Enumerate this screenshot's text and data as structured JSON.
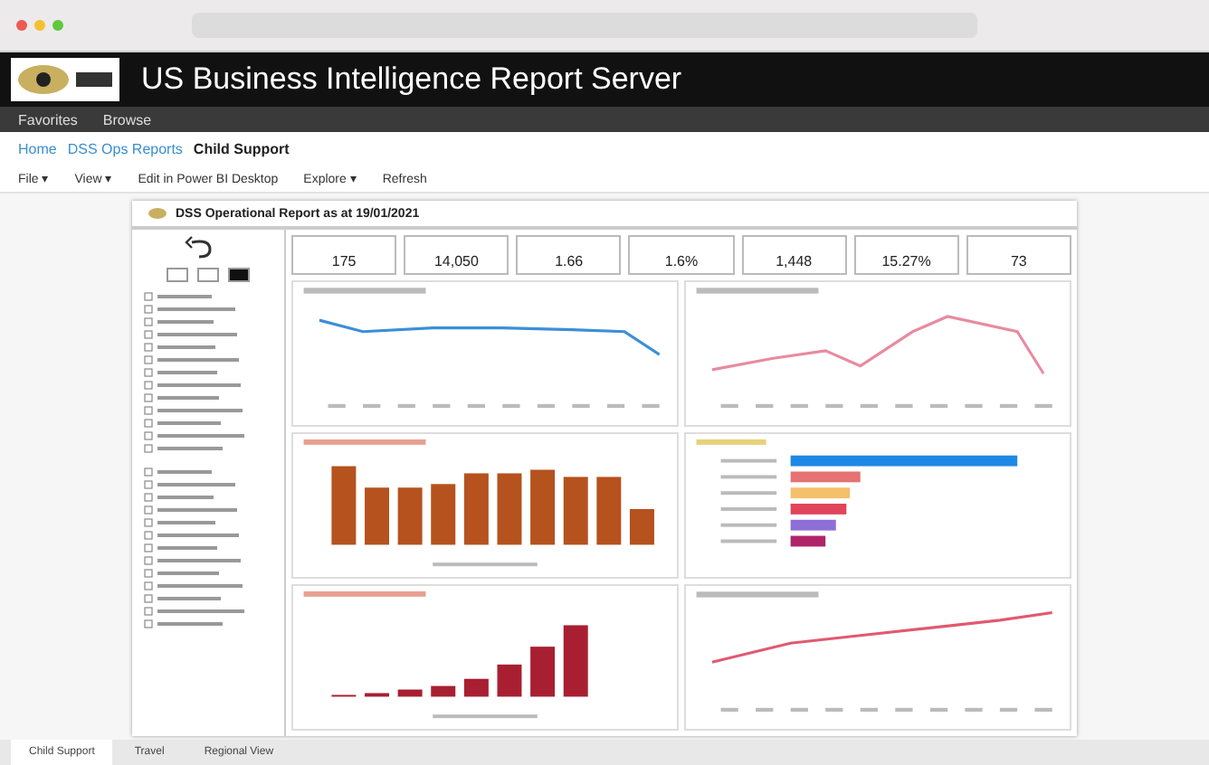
{
  "header": {
    "title": "US Business Intelligence Report Server"
  },
  "nav": [
    "Favorites",
    "Browse"
  ],
  "breadcrumb": [
    {
      "label": "Home",
      "selected": false
    },
    {
      "label": "DSS Ops Reports",
      "selected": false
    },
    {
      "label": "Child Support",
      "selected": true
    }
  ],
  "toolbar": [
    "File ▾",
    "View ▾",
    "Edit in Power BI Desktop",
    "Explore ▾",
    "Refresh"
  ],
  "report": {
    "title": "DSS Operational Report as at 19/01/2021",
    "kpis": [
      "175",
      "14,050",
      "1.66",
      "1.6%",
      "1,448",
      "15.27%",
      "73"
    ],
    "toggles": [
      {
        "selected": false
      },
      {
        "selected": false
      },
      {
        "selected": true
      }
    ]
  },
  "page_tabs": [
    {
      "label": "Child Support",
      "selected": true
    },
    {
      "label": "Travel",
      "selected": false
    },
    {
      "label": "Regional View",
      "selected": false
    }
  ]
}
